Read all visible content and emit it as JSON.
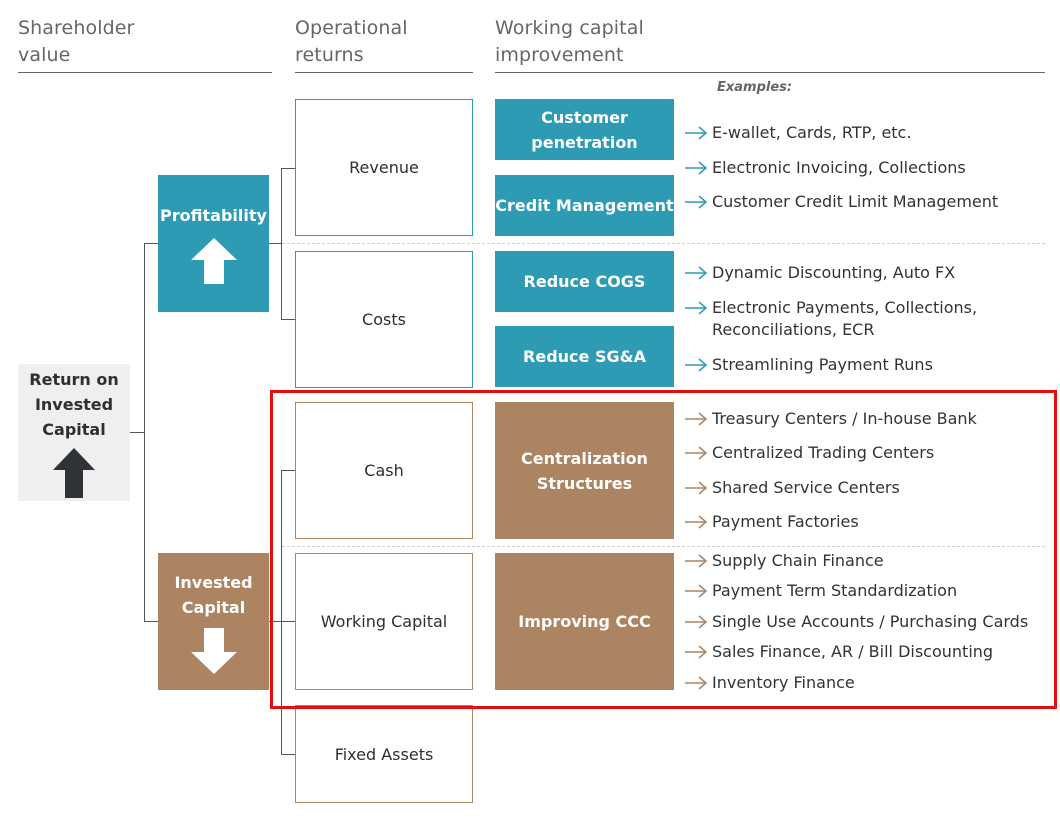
{
  "headers": {
    "shareholder_value": "Shareholder\nvalue",
    "operational_returns": "Operational\nreturns",
    "working_capital_improvement": "Working capital\nimprovement"
  },
  "roic": {
    "label": "Return on\nInvested\nCapital",
    "arrow": "up-arrow-icon"
  },
  "drivers": {
    "profitability": {
      "label": "Profitability",
      "arrow": "up-arrow-icon"
    },
    "invested_capital": {
      "label": "Invested\nCapital",
      "arrow": "down-arrow-icon"
    }
  },
  "operational": {
    "revenue": "Revenue",
    "costs": "Costs",
    "cash": "Cash",
    "working_capital": "Working Capital",
    "fixed_assets": "Fixed Assets"
  },
  "improvements": {
    "customer_penetration": "Customer\npenetration",
    "credit_management": "Credit Management",
    "reduce_cogs": "Reduce COGS",
    "reduce_sga": "Reduce SG&A",
    "centralization_structures": "Centralization\nStructures",
    "improving_ccc": "Improving CCC"
  },
  "examples_label": "Examples:",
  "examples": {
    "customer_penetration": [
      "E-wallet, Cards, RTP, etc.",
      "Electronic Invoicing, Collections"
    ],
    "credit_management": [
      "Customer Credit Limit Management"
    ],
    "reduce_cogs": [
      "Dynamic Discounting, Auto FX",
      "Electronic Payments, Collections,\nReconciliations, ECR"
    ],
    "reduce_sga": [
      "Streamlining Payment Runs"
    ],
    "centralization_structures": [
      "Treasury Centers / In-house Bank",
      "Centralized Trading Centers",
      "Shared Service Centers",
      "Payment Factories"
    ],
    "improving_ccc": [
      "Supply Chain Finance",
      "Payment Term Standardization",
      "Single Use Accounts / Purchasing Cards",
      "Sales Finance, AR / Bill Discounting",
      "Inventory Finance"
    ]
  },
  "colors": {
    "teal": "#2e9bb5",
    "brown": "#ad8462",
    "highlight_red": "#e01010",
    "roic_bg": "#efefef",
    "dark_arrow": "#2f3237"
  }
}
